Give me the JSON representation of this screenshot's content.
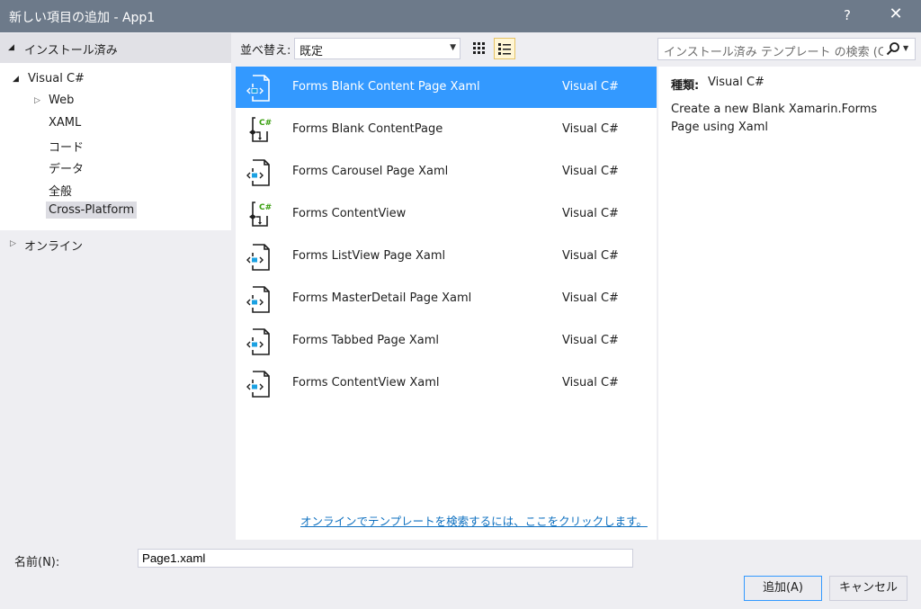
{
  "window": {
    "title": "新しい項目の追加 - App1",
    "help": "?",
    "close": "✕"
  },
  "left": {
    "installed": "インストール済み",
    "tree": [
      {
        "label": "Visual C#"
      },
      {
        "label": "Web"
      },
      {
        "label": "XAML"
      },
      {
        "label": "コード"
      },
      {
        "label": "データ"
      },
      {
        "label": "全般"
      },
      {
        "label": "Cross-Platform",
        "selected": true
      }
    ],
    "online": "オンライン"
  },
  "toolbar": {
    "sort_label": "並べ替え:",
    "sort_value": "既定",
    "search_placeholder": "インストール済み テンプレート の検索 (Ctrl+E)"
  },
  "templates": [
    {
      "name": "Forms Blank Content Page Xaml",
      "type": "Visual C#",
      "icon": "xaml-page-icon",
      "selected": true
    },
    {
      "name": "Forms Blank ContentPage",
      "type": "Visual C#",
      "icon": "csharp-class-icon"
    },
    {
      "name": "Forms Carousel Page Xaml",
      "type": "Visual C#",
      "icon": "xaml-page-icon"
    },
    {
      "name": "Forms ContentView",
      "type": "Visual C#",
      "icon": "csharp-class-icon"
    },
    {
      "name": "Forms ListView Page Xaml",
      "type": "Visual C#",
      "icon": "xaml-page-icon"
    },
    {
      "name": "Forms MasterDetail Page Xaml",
      "type": "Visual C#",
      "icon": "xaml-page-icon"
    },
    {
      "name": "Forms Tabbed Page Xaml",
      "type": "Visual C#",
      "icon": "xaml-page-icon"
    },
    {
      "name": "Forms ContentView Xaml",
      "type": "Visual C#",
      "icon": "xaml-page-icon"
    }
  ],
  "online_link": "オンラインでテンプレートを検索するには、ここをクリックします。",
  "details": {
    "kind_label": "種類:",
    "kind_value": "Visual C#",
    "description": "Create a new Blank Xamarin.Forms Page using Xaml"
  },
  "footer": {
    "name_label": "名前(N):",
    "name_value": "Page1.xaml",
    "add_button": "追加(A)",
    "cancel_button": "キャンセル"
  },
  "colors": {
    "titlebar": "#6d7a8a",
    "selection": "#3399ff",
    "link": "#0e70c0",
    "csharp_green": "#389e0d"
  }
}
